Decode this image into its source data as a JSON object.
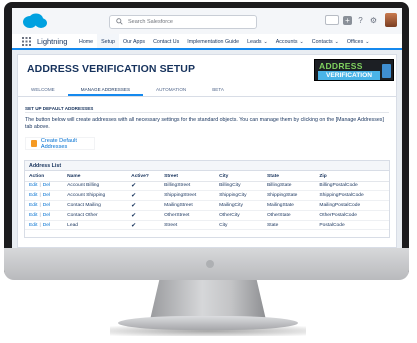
{
  "header": {
    "search_placeholder": "Search Salesforce"
  },
  "nav": {
    "app_name": "Lightning",
    "items": [
      {
        "label": "Home",
        "caret": false
      },
      {
        "label": "Setup",
        "caret": false
      },
      {
        "label": "Our Apps",
        "caret": false
      },
      {
        "label": "Contact Us",
        "caret": false
      },
      {
        "label": "Implementation Guide",
        "caret": false
      },
      {
        "label": "Leads",
        "caret": true
      },
      {
        "label": "Accounts",
        "caret": true
      },
      {
        "label": "Contacts",
        "caret": true
      },
      {
        "label": "Offices",
        "caret": true
      }
    ],
    "active_index": 1
  },
  "page": {
    "title": "ADDRESS VERIFICATION SETUP",
    "brand_top": "ADDRESS",
    "brand_bottom": "VERIFICATION",
    "tabs": [
      "WELCOME",
      "MANAGE ADDRESSES",
      "AUTOMATION",
      "BETA"
    ],
    "active_tab": 1,
    "section_label": "SET UP DEFAULT ADDRESSES",
    "description": "The button below will create addresses with all necessary settings for the standard objects. You can manage them by clicking on the [Manage Addresses] tab above.",
    "create_button": "Create Default Addresses"
  },
  "address_list": {
    "title": "Address List",
    "columns": [
      "Action",
      "Name",
      "Active?",
      "Street",
      "City",
      "State",
      "Zip"
    ],
    "action_edit": "Edit",
    "action_sep": "|",
    "action_del": "Del",
    "rows": [
      {
        "name": "Account Billing",
        "active": "✔",
        "street": "BillingStreet",
        "city": "BillingCity",
        "state": "BillingState",
        "zip": "BillingPostalCode"
      },
      {
        "name": "Account Shipping",
        "active": "✔",
        "street": "ShippingStreet",
        "city": "ShippingCity",
        "state": "ShippingState",
        "zip": "ShippingPostalCode"
      },
      {
        "name": "Contact Mailing",
        "active": "✔",
        "street": "MailingStreet",
        "city": "MailingCity",
        "state": "MailingState",
        "zip": "MailingPostalCode"
      },
      {
        "name": "Contact Other",
        "active": "✔",
        "street": "OtherStreet",
        "city": "OtherCity",
        "state": "OtherState",
        "zip": "OtherPostalCode"
      },
      {
        "name": "Lead",
        "active": "✔",
        "street": "Street",
        "city": "City",
        "state": "State",
        "zip": "PostalCode"
      }
    ]
  },
  "colors": {
    "accent": "#1589ee",
    "link": "#0070d2",
    "brand_green": "#7fd15f",
    "brand_blue": "#4ab4e8"
  }
}
